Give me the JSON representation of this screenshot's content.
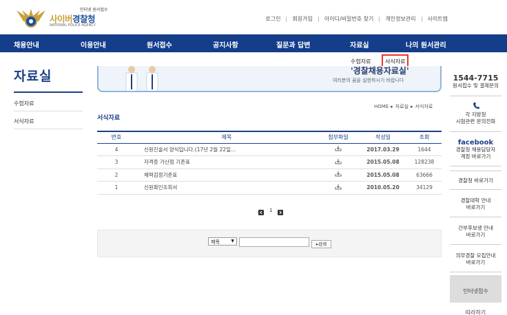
{
  "header": {
    "logo_small": "인터넷 원서접수",
    "logo_main_a": "사이버",
    "logo_main_b": "경찰청",
    "logo_eng": "NATIONAL POLICE AGENCY",
    "links": [
      "로그인",
      "회원가입",
      "아이디/비밀번호 찾기",
      "개인정보관리",
      "사이트맵"
    ]
  },
  "nav": {
    "items": [
      "채용안내",
      "이용안내",
      "원서접수",
      "공지사항",
      "질문과 답변",
      "자료실",
      "나의 원서관리"
    ]
  },
  "subnav": {
    "items": [
      "수험자료",
      "서식자료"
    ],
    "active": "서식자료"
  },
  "sidebar": {
    "title": "자료실",
    "items": [
      "수험자료",
      "서식자료"
    ]
  },
  "banner": {
    "headline": "'경찰채용자료실'",
    "sub": "여러분의 꿈을 실현하시기 바랍니다"
  },
  "breadcrumb": [
    "HOME",
    "자료실",
    "서식자료"
  ],
  "section_title": "서식자료",
  "table": {
    "headers": [
      "번호",
      "제목",
      "첨부파일",
      "작성일",
      "조회"
    ],
    "rows": [
      {
        "no": "4",
        "title": "신원진술서 양식입니다.(17년 2월 22일...",
        "date": "2017.03.29",
        "views": "1644"
      },
      {
        "no": "3",
        "title": "자격증 가산점 기준표",
        "date": "2015.05.08",
        "views": "128238"
      },
      {
        "no": "2",
        "title": "체력검정기준표",
        "date": "2015.05.08",
        "views": "63666"
      },
      {
        "no": "1",
        "title": "신원확인조회서",
        "date": "2010.05.20",
        "views": "34129"
      }
    ]
  },
  "pager": {
    "current": "1"
  },
  "search": {
    "select_value": "제목",
    "input_value": "",
    "button_label": "검색"
  },
  "rail": {
    "phone": "1544-7715",
    "phone_desc": "원서접수 및 결제문의",
    "regional_a": "각 지방청",
    "regional_b": "시험관련 문의전화",
    "facebook": "facebook",
    "fb_desc_a": "경찰청 채용담당자",
    "fb_desc_b": "계정 바로가기",
    "links": [
      [
        "경찰청 바로가기"
      ],
      [
        "경찰대학 안내",
        "바로가기"
      ],
      [
        "간부후보생 안내",
        "바로가기"
      ],
      [
        "의무경찰 모집안내",
        "바로가기"
      ]
    ],
    "follow_a": "인터넷접수",
    "follow_b": "따라하기"
  },
  "colors": {
    "nav": "#143d8a",
    "accent": "#1b3f86",
    "highlight": "#e8332a"
  }
}
